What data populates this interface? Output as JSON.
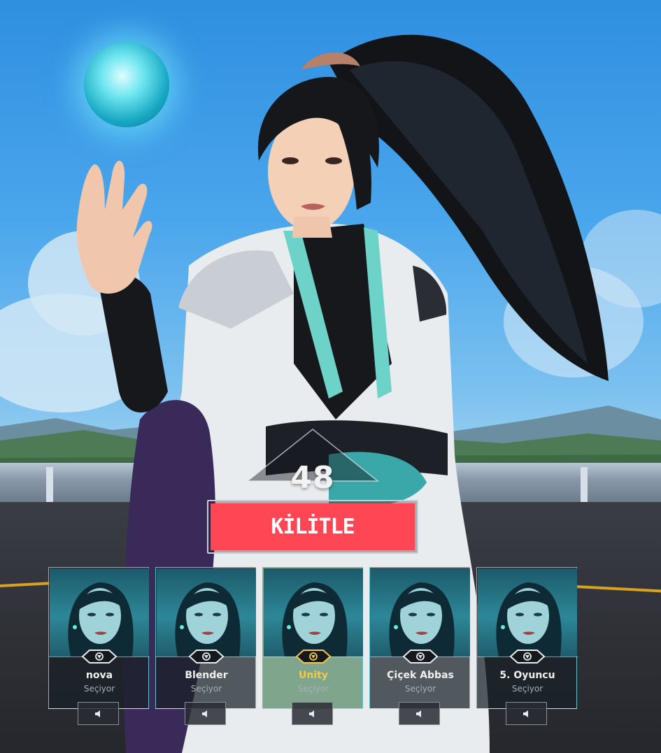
{
  "screen": "agent-select",
  "timer": {
    "seconds": "48"
  },
  "lock_button": {
    "label": "KİLİTLE",
    "color": "#ff4655"
  },
  "agent_orb": {
    "icon": "orb-icon",
    "color": "#6fe6f0"
  },
  "party": [
    {
      "name": "nova",
      "status": "Seçiyor",
      "role_icon": "controller-role-icon",
      "voice_icon": "speaker-icon",
      "highlighted": false
    },
    {
      "name": "Blender",
      "status": "Seçiyor",
      "role_icon": "controller-role-icon",
      "voice_icon": "speaker-icon",
      "highlighted": false
    },
    {
      "name": "Unity",
      "status": "Seçiyor",
      "role_icon": "controller-role-icon",
      "voice_icon": "speaker-icon",
      "highlighted": true
    },
    {
      "name": "Çiçek Abbas",
      "status": "Seçiyor",
      "role_icon": "controller-role-icon",
      "voice_icon": "speaker-icon",
      "highlighted": false
    },
    {
      "name": "5. Oyuncu",
      "status": "Seçiyor",
      "role_icon": "controller-role-icon",
      "voice_icon": "speaker-icon",
      "highlighted": false
    }
  ],
  "colors": {
    "highlight": "#f2c94c",
    "accent": "#5fc2cc"
  }
}
